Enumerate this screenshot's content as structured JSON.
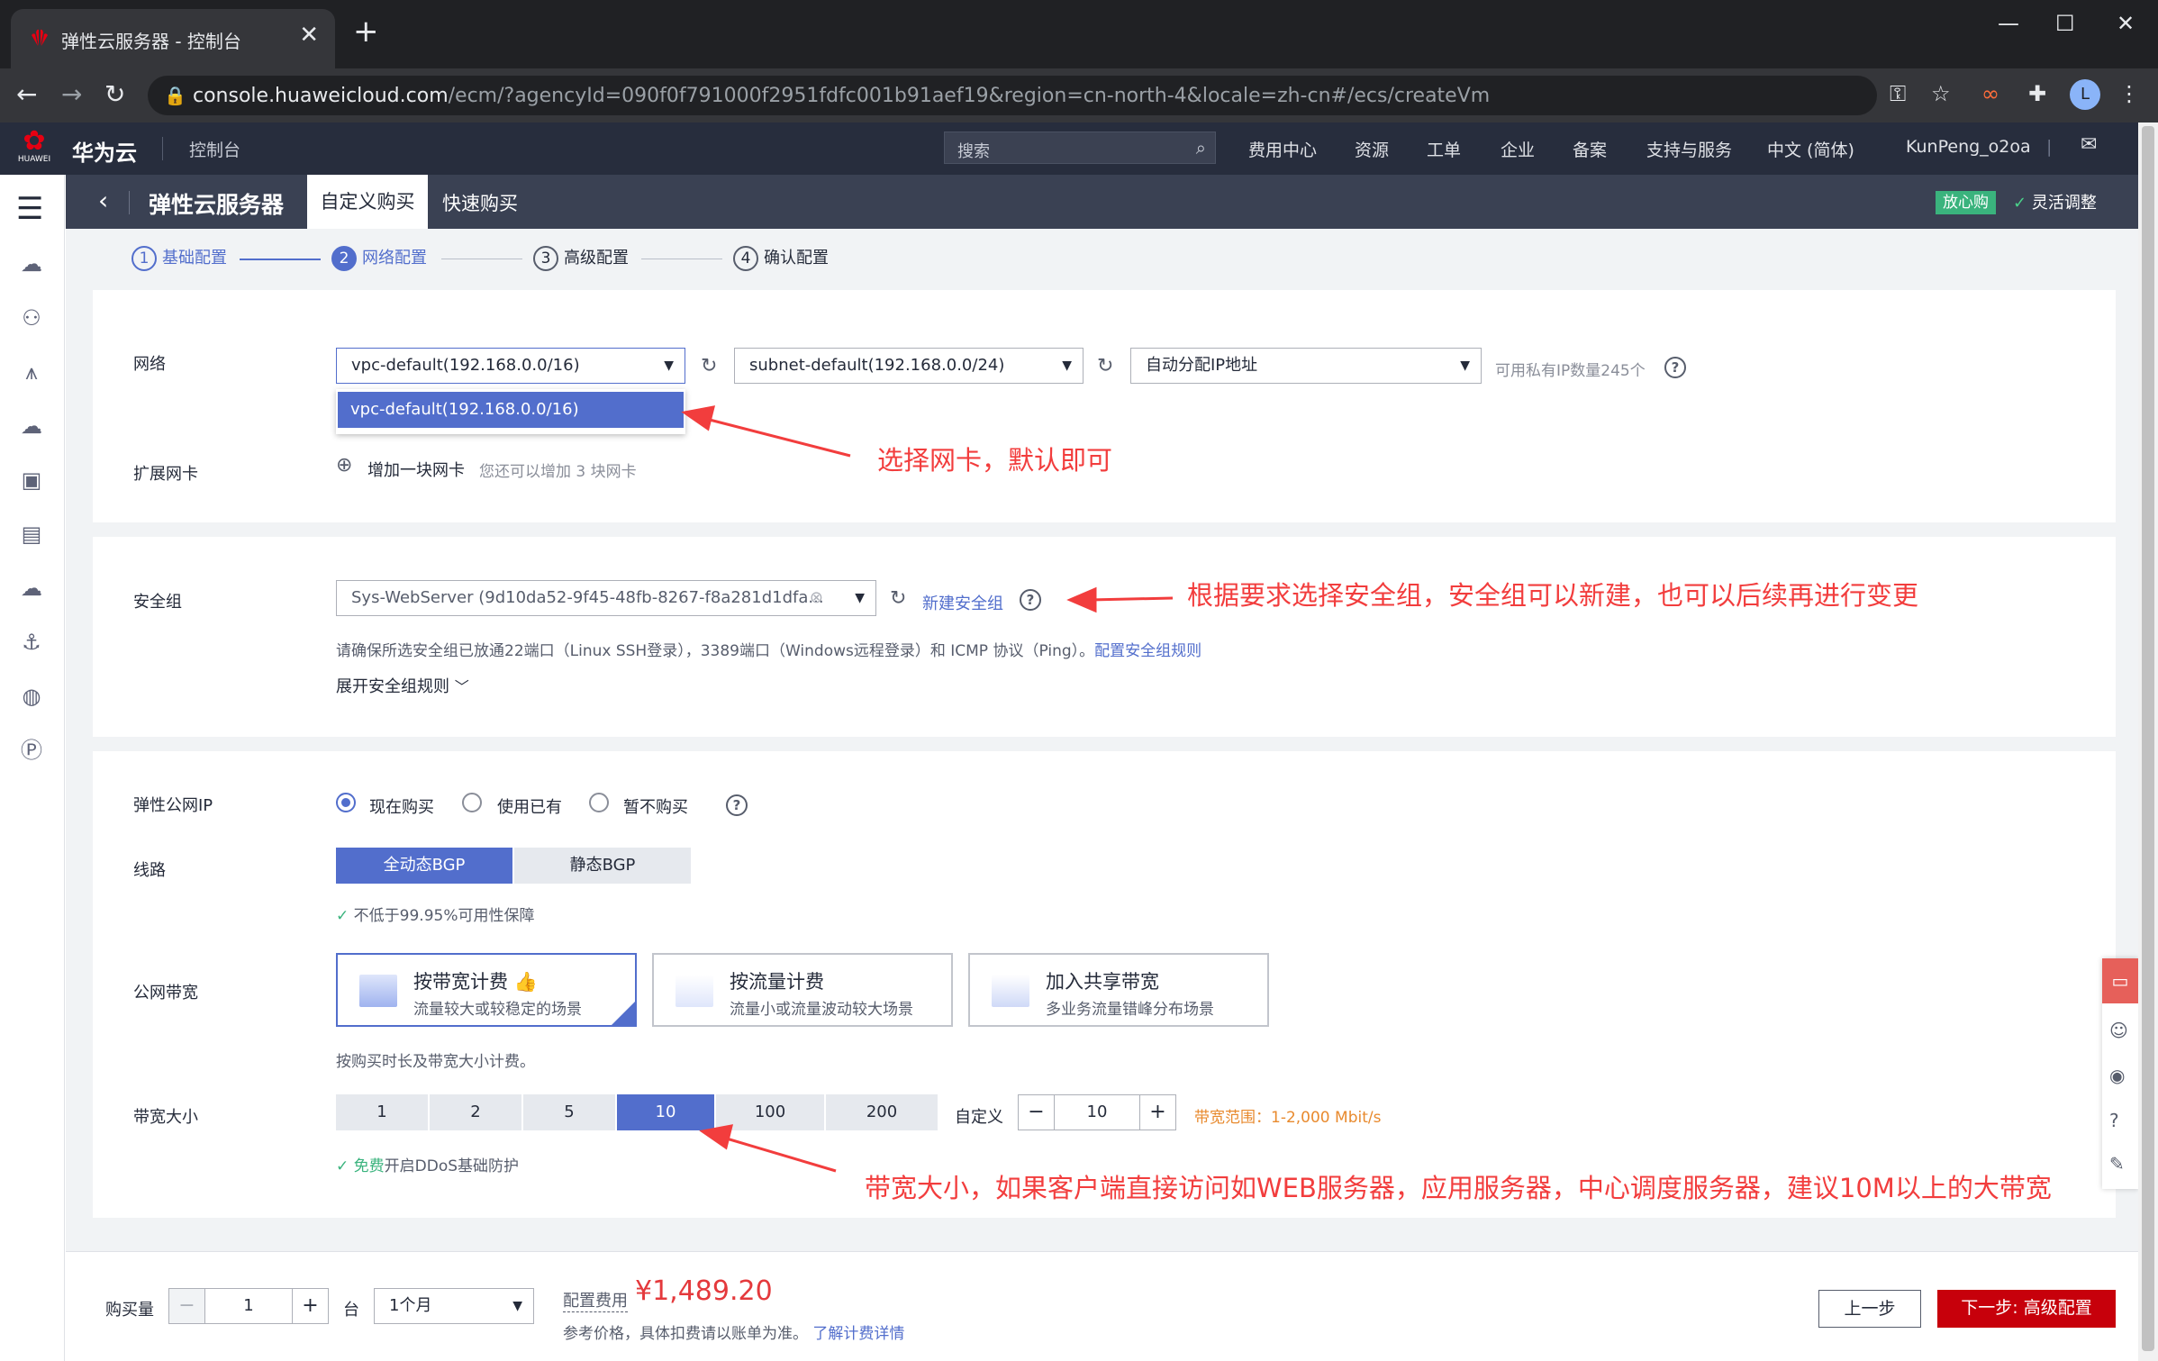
{
  "browser": {
    "tab_title": "弹性云服务器 - 控制台",
    "url_host": "console.huaweicloud.com",
    "url_rest": "/ecm/?agencyId=090f0f791000f2951fdfc001b91aef19&region=cn-north-4&locale=zh-cn#/ecs/createVm",
    "avatar_letter": "L"
  },
  "header": {
    "brand_name": "华为云",
    "logo_text": "HUAWEI",
    "console_label": "控制台",
    "search_placeholder": "搜索",
    "nav": [
      "费用中心",
      "资源",
      "工单",
      "企业",
      "备案",
      "支持与服务",
      "中文 (简体)",
      "KunPeng_o2oa"
    ]
  },
  "titlebar": {
    "service_title": "弹性云服务器",
    "tab_custom": "自定义购买",
    "tab_quick": "快速购买",
    "badge": "放心购",
    "flex_adjust": "灵活调整"
  },
  "steps": [
    {
      "num": "1",
      "label": "基础配置"
    },
    {
      "num": "2",
      "label": "网络配置"
    },
    {
      "num": "3",
      "label": "高级配置"
    },
    {
      "num": "4",
      "label": "确认配置"
    }
  ],
  "network": {
    "label": "网络",
    "vpc_value": "vpc-default(192.168.0.0/16)",
    "vpc_option": "vpc-default(192.168.0.0/16)",
    "subnet_value": "subnet-default(192.168.0.0/24)",
    "ip_value": "自动分配IP地址",
    "ip_available": "可用私有IP数量245个",
    "ext_nic_label": "扩展网卡",
    "add_nic": "增加一块网卡",
    "add_nic_hint": "您还可以增加 3 块网卡",
    "annotation": "选择网卡，默认即可"
  },
  "security": {
    "label": "安全组",
    "value": "Sys-WebServer (9d10da52-9f45-48fb-8267-f8a281d1dfa...",
    "new_link": "新建安全组",
    "hint": "请确保所选安全组已放通22端口（Linux SSH登录），3389端口（Windows远程登录）和 ICMP 协议（Ping）。",
    "hint_link": "配置安全组规则",
    "expand": "展开安全组规则",
    "annotation": "根据要求选择安全组，安全组可以新建，也可以后续再进行变更"
  },
  "eip": {
    "label": "弹性公网IP",
    "options": [
      "现在购买",
      "使用已有",
      "暂不购买"
    ],
    "line_label": "线路",
    "lines": [
      "全动态BGP",
      "静态BGP"
    ],
    "line_note": "不低于99.95%可用性保障",
    "bw_label": "公网带宽",
    "bw_cards": [
      {
        "title": "按带宽计费",
        "desc": "流量较大或较稳定的场景"
      },
      {
        "title": "按流量计费",
        "desc": "流量小或流量波动较大场景"
      },
      {
        "title": "加入共享带宽",
        "desc": "多业务流量错峰分布场景"
      }
    ],
    "bw_note": "按购买时长及带宽大小计费。",
    "size_label": "带宽大小",
    "sizes": [
      "1",
      "2",
      "5",
      "10",
      "100",
      "200"
    ],
    "custom_label": "自定义",
    "custom_value": "10",
    "range": "带宽范围：1-2,000 Mbit/s",
    "ddos_free": "免费",
    "ddos_text": "开启DDoS基础防护",
    "annotation": "带宽大小，如果客户端直接访问如WEB服务器，应用服务器，中心调度服务器，建议10M以上的大带宽"
  },
  "footer": {
    "qty_label": "购买量",
    "qty_value": "1",
    "unit": "台",
    "duration": "1个月",
    "fee_label": "配置费用",
    "price": "¥1,489.20",
    "fee_note": "参考价格，具体扣费请以账单为准。",
    "fee_link": "了解计费详情",
    "prev": "上一步",
    "next": "下一步: 高级配置"
  },
  "colors": {
    "primary": "#526ecc",
    "annotation_red": "#f23d3d",
    "price_red": "#e4393c",
    "next_btn": "#c7000b",
    "success": "#3ab37d",
    "header_bg": "#272d3d"
  }
}
